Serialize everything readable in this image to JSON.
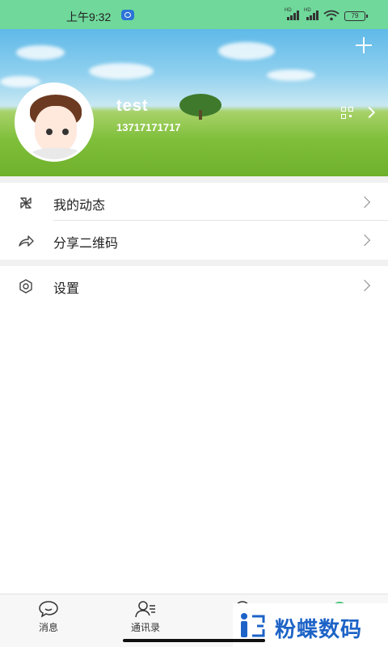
{
  "status_bar": {
    "time": "上午9:32",
    "signal_1": "HD",
    "signal_2": "HD",
    "battery": "79"
  },
  "profile": {
    "username": "test",
    "phone": "13717171717"
  },
  "menu": {
    "items": [
      {
        "label": "我的动态",
        "icon": "pinwheel-icon"
      },
      {
        "label": "分享二维码",
        "icon": "share-icon"
      },
      {
        "label": "设置",
        "icon": "settings-hexagon-icon"
      }
    ]
  },
  "bottom_nav": {
    "tabs": [
      {
        "label": "消息",
        "icon": "chat-bubble-icon"
      },
      {
        "label": "通讯录",
        "icon": "contacts-icon"
      },
      {
        "label": "",
        "icon": "discover-icon"
      },
      {
        "label": "",
        "icon": "me-icon",
        "active": true
      }
    ]
  },
  "watermark": {
    "text": "粉蝶数码"
  },
  "colors": {
    "status_bar_bg": "#6fd89a",
    "active_tab": "#4cc47a",
    "watermark_text": "#1d63c7"
  }
}
